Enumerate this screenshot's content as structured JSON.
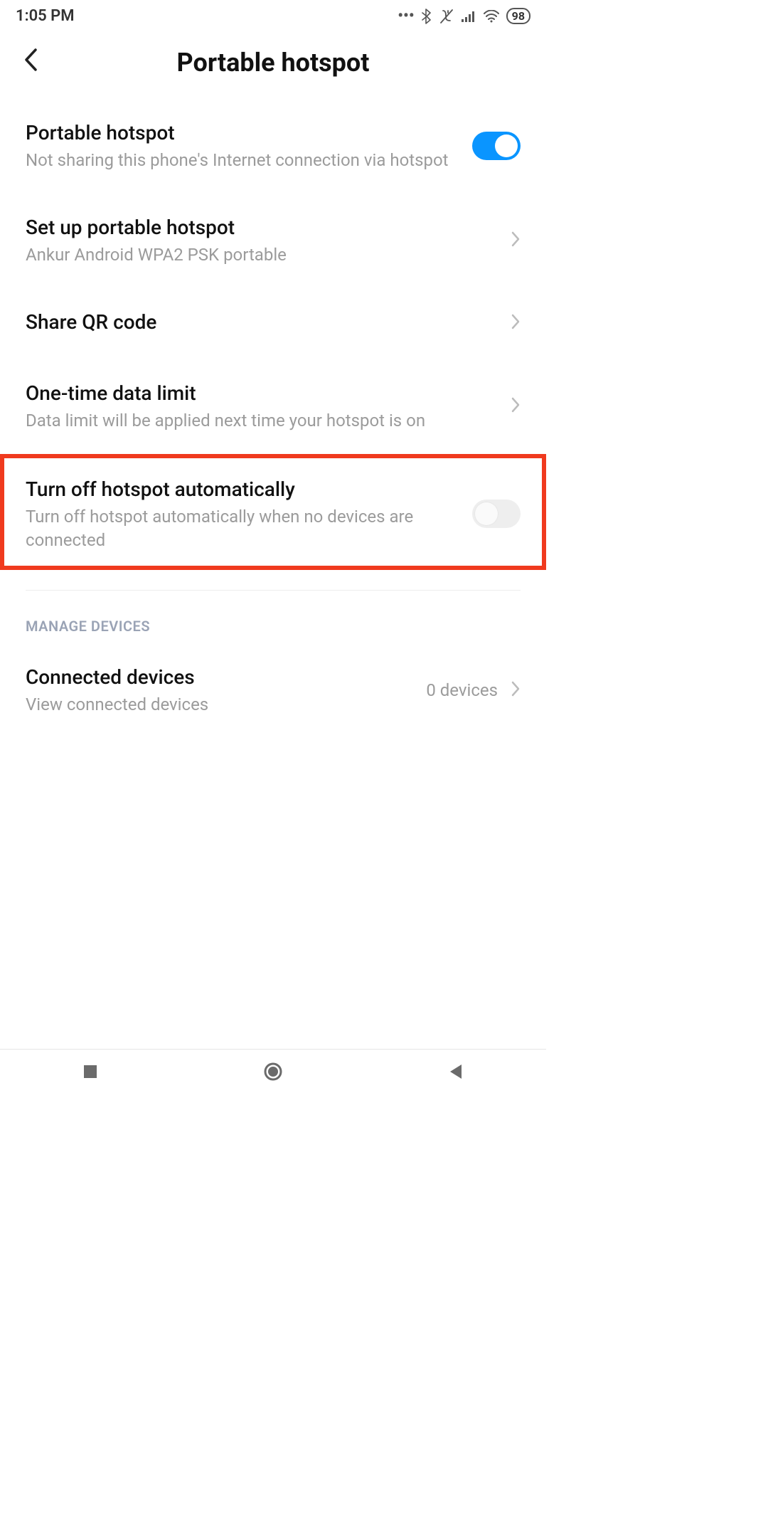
{
  "status": {
    "time": "1:05 PM",
    "battery": "98"
  },
  "header": {
    "title": "Portable hotspot"
  },
  "rows": {
    "hotspot": {
      "title": "Portable hotspot",
      "sub": "Not sharing this phone's Internet connection via hotspot",
      "toggle_on": true
    },
    "setup": {
      "title": "Set up portable hotspot",
      "sub": "Ankur Android WPA2 PSK portable"
    },
    "qr": {
      "title": "Share QR code"
    },
    "datalimit": {
      "title": "One-time data limit",
      "sub": "Data limit will be applied next time your hotspot is on"
    },
    "autooff": {
      "title": "Turn off hotspot automatically",
      "sub": "Turn off hotspot automatically when no devices are connected",
      "toggle_on": false
    }
  },
  "section": {
    "manage": "MANAGE DEVICES"
  },
  "connected": {
    "title": "Connected devices",
    "sub": "View connected devices",
    "value": "0 devices"
  }
}
